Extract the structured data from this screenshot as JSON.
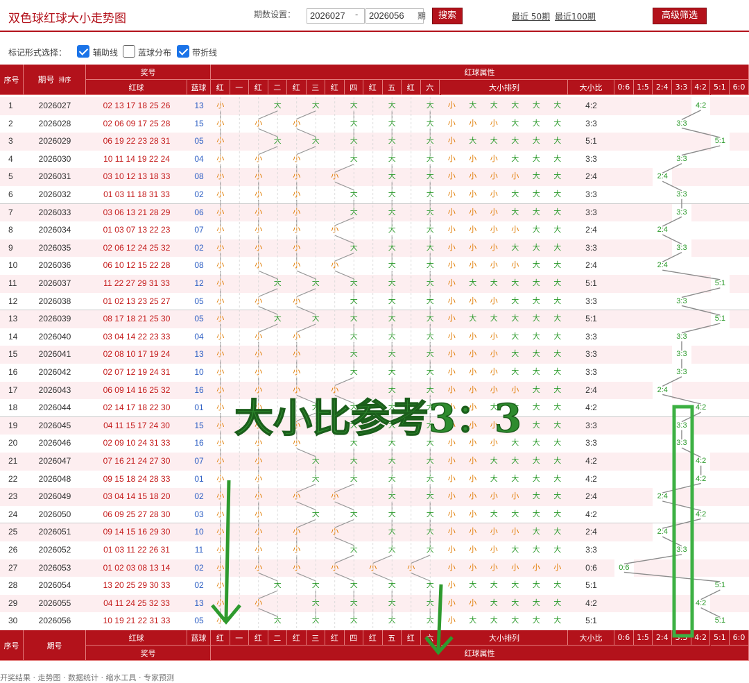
{
  "header": {
    "title": "双色球红球大小走势图",
    "period_label": "期数设置：",
    "from": "2026027",
    "dash": "-",
    "to": "2026056",
    "unit": "期",
    "search": "搜索",
    "recent50": "最近 50期",
    "recent100": "最近100期",
    "advanced": "高级筛选"
  },
  "markbar": {
    "label": "标记形式选择：",
    "aux": "辅助线",
    "blue": "蓝球分布",
    "line": "带折线"
  },
  "table_head": {
    "seq": "序号",
    "period": "期号",
    "sort": "排序",
    "prize": "奖号",
    "red": "红球",
    "blue": "蓝球",
    "attr": "红球属性",
    "size_order": "大小排列",
    "ratio": "大小比",
    "pos": [
      "红",
      "一",
      "红",
      "二",
      "红",
      "三",
      "红",
      "四",
      "红",
      "五",
      "红",
      "六"
    ],
    "ratios": [
      "0:6",
      "1:5",
      "2:4",
      "3:3",
      "4:2",
      "5:1",
      "6:0"
    ]
  },
  "overlay": {
    "text": "大小比参考3：3"
  },
  "footer": "开奖结果 · 走势图 · 数据统计 · 缩水工具 · 专家预测",
  "labels": {
    "small": "小",
    "big": "大"
  },
  "colors": {
    "header_red": "#b3121b",
    "accent_green": "#2e8b2e",
    "small": "#e07b00",
    "big": "#2a9a2a"
  },
  "rows": [
    {
      "seq": "1",
      "period": "2026027",
      "red": "02 13 17 18 25 26",
      "blue": "13",
      "attr": "011111",
      "ratio": "4:2"
    },
    {
      "seq": "2",
      "period": "2026028",
      "red": "02 06 09 17 25 28",
      "blue": "15",
      "attr": "000111",
      "ratio": "3:3"
    },
    {
      "seq": "3",
      "period": "2026029",
      "red": "06 19 22 23 28 31",
      "blue": "05",
      "attr": "011111",
      "ratio": "5:1"
    },
    {
      "seq": "4",
      "period": "2026030",
      "red": "10 11 14 19 22 24",
      "blue": "04",
      "attr": "000111",
      "ratio": "3:3"
    },
    {
      "seq": "5",
      "period": "2026031",
      "red": "03 10 12 13 18 33",
      "blue": "08",
      "attr": "000011",
      "ratio": "2:4"
    },
    {
      "seq": "6",
      "period": "2026032",
      "red": "01 03 11 18 31 33",
      "blue": "02",
      "attr": "000111",
      "ratio": "3:3"
    },
    {
      "seq": "7",
      "period": "2026033",
      "red": "03 06 13 21 28 29",
      "blue": "06",
      "attr": "000111",
      "ratio": "3:3"
    },
    {
      "seq": "8",
      "period": "2026034",
      "red": "01 03 07 13 22 23",
      "blue": "07",
      "attr": "000011",
      "ratio": "2:4"
    },
    {
      "seq": "9",
      "period": "2026035",
      "red": "02 06 12 24 25 32",
      "blue": "02",
      "attr": "000111",
      "ratio": "3:3"
    },
    {
      "seq": "10",
      "period": "2026036",
      "red": "06 10 12 15 22 28",
      "blue": "08",
      "attr": "000011",
      "ratio": "2:4"
    },
    {
      "seq": "11",
      "period": "2026037",
      "red": "11 22 27 29 31 33",
      "blue": "12",
      "attr": "011111",
      "ratio": "5:1"
    },
    {
      "seq": "12",
      "period": "2026038",
      "red": "01 02 13 23 25 27",
      "blue": "05",
      "attr": "000111",
      "ratio": "3:3"
    },
    {
      "seq": "13",
      "period": "2026039",
      "red": "08 17 18 21 25 30",
      "blue": "05",
      "attr": "011111",
      "ratio": "5:1"
    },
    {
      "seq": "14",
      "period": "2026040",
      "red": "03 04 14 22 23 33",
      "blue": "04",
      "attr": "000111",
      "ratio": "3:3"
    },
    {
      "seq": "15",
      "period": "2026041",
      "red": "02 08 10 17 19 24",
      "blue": "13",
      "attr": "000111",
      "ratio": "3:3"
    },
    {
      "seq": "16",
      "period": "2026042",
      "red": "02 07 12 19 24 31",
      "blue": "10",
      "attr": "000111",
      "ratio": "3:3"
    },
    {
      "seq": "17",
      "period": "2026043",
      "red": "06 09 14 16 25 32",
      "blue": "16",
      "attr": "000011",
      "ratio": "2:4"
    },
    {
      "seq": "18",
      "period": "2026044",
      "red": "02 14 17 18 22 30",
      "blue": "01",
      "attr": "001111",
      "ratio": "4:2"
    },
    {
      "seq": "19",
      "period": "2026045",
      "red": "04 11 15 17 24 30",
      "blue": "15",
      "attr": "000111",
      "ratio": "3:3"
    },
    {
      "seq": "20",
      "period": "2026046",
      "red": "02 09 10 24 31 33",
      "blue": "16",
      "attr": "000111",
      "ratio": "3:3"
    },
    {
      "seq": "21",
      "period": "2026047",
      "red": "07 16 21 24 27 30",
      "blue": "07",
      "attr": "001111",
      "ratio": "4:2"
    },
    {
      "seq": "22",
      "period": "2026048",
      "red": "09 15 18 24 28 33",
      "blue": "01",
      "attr": "001111",
      "ratio": "4:2"
    },
    {
      "seq": "23",
      "period": "2026049",
      "red": "03 04 14 15 18 20",
      "blue": "02",
      "attr": "000011",
      "ratio": "2:4"
    },
    {
      "seq": "24",
      "period": "2026050",
      "red": "06 09 25 27 28 30",
      "blue": "03",
      "attr": "001111",
      "ratio": "4:2"
    },
    {
      "seq": "25",
      "period": "2026051",
      "red": "09 14 15 16 29 30",
      "blue": "10",
      "attr": "000011",
      "ratio": "2:4"
    },
    {
      "seq": "26",
      "period": "2026052",
      "red": "01 03 11 22 26 31",
      "blue": "11",
      "attr": "000111",
      "ratio": "3:3"
    },
    {
      "seq": "27",
      "period": "2026053",
      "red": "01 02 03 08 13 14",
      "blue": "02",
      "attr": "000000",
      "ratio": "0:6"
    },
    {
      "seq": "28",
      "period": "2026054",
      "red": "13 20 25 29 30 33",
      "blue": "02",
      "attr": "011111",
      "ratio": "5:1"
    },
    {
      "seq": "29",
      "period": "2026055",
      "red": "04 11 24 25 32 33",
      "blue": "13",
      "attr": "001111",
      "ratio": "4:2"
    },
    {
      "seq": "30",
      "period": "2026056",
      "red": "10 19 21 22 31 33",
      "blue": "05",
      "attr": "011111",
      "ratio": "5:1"
    }
  ]
}
